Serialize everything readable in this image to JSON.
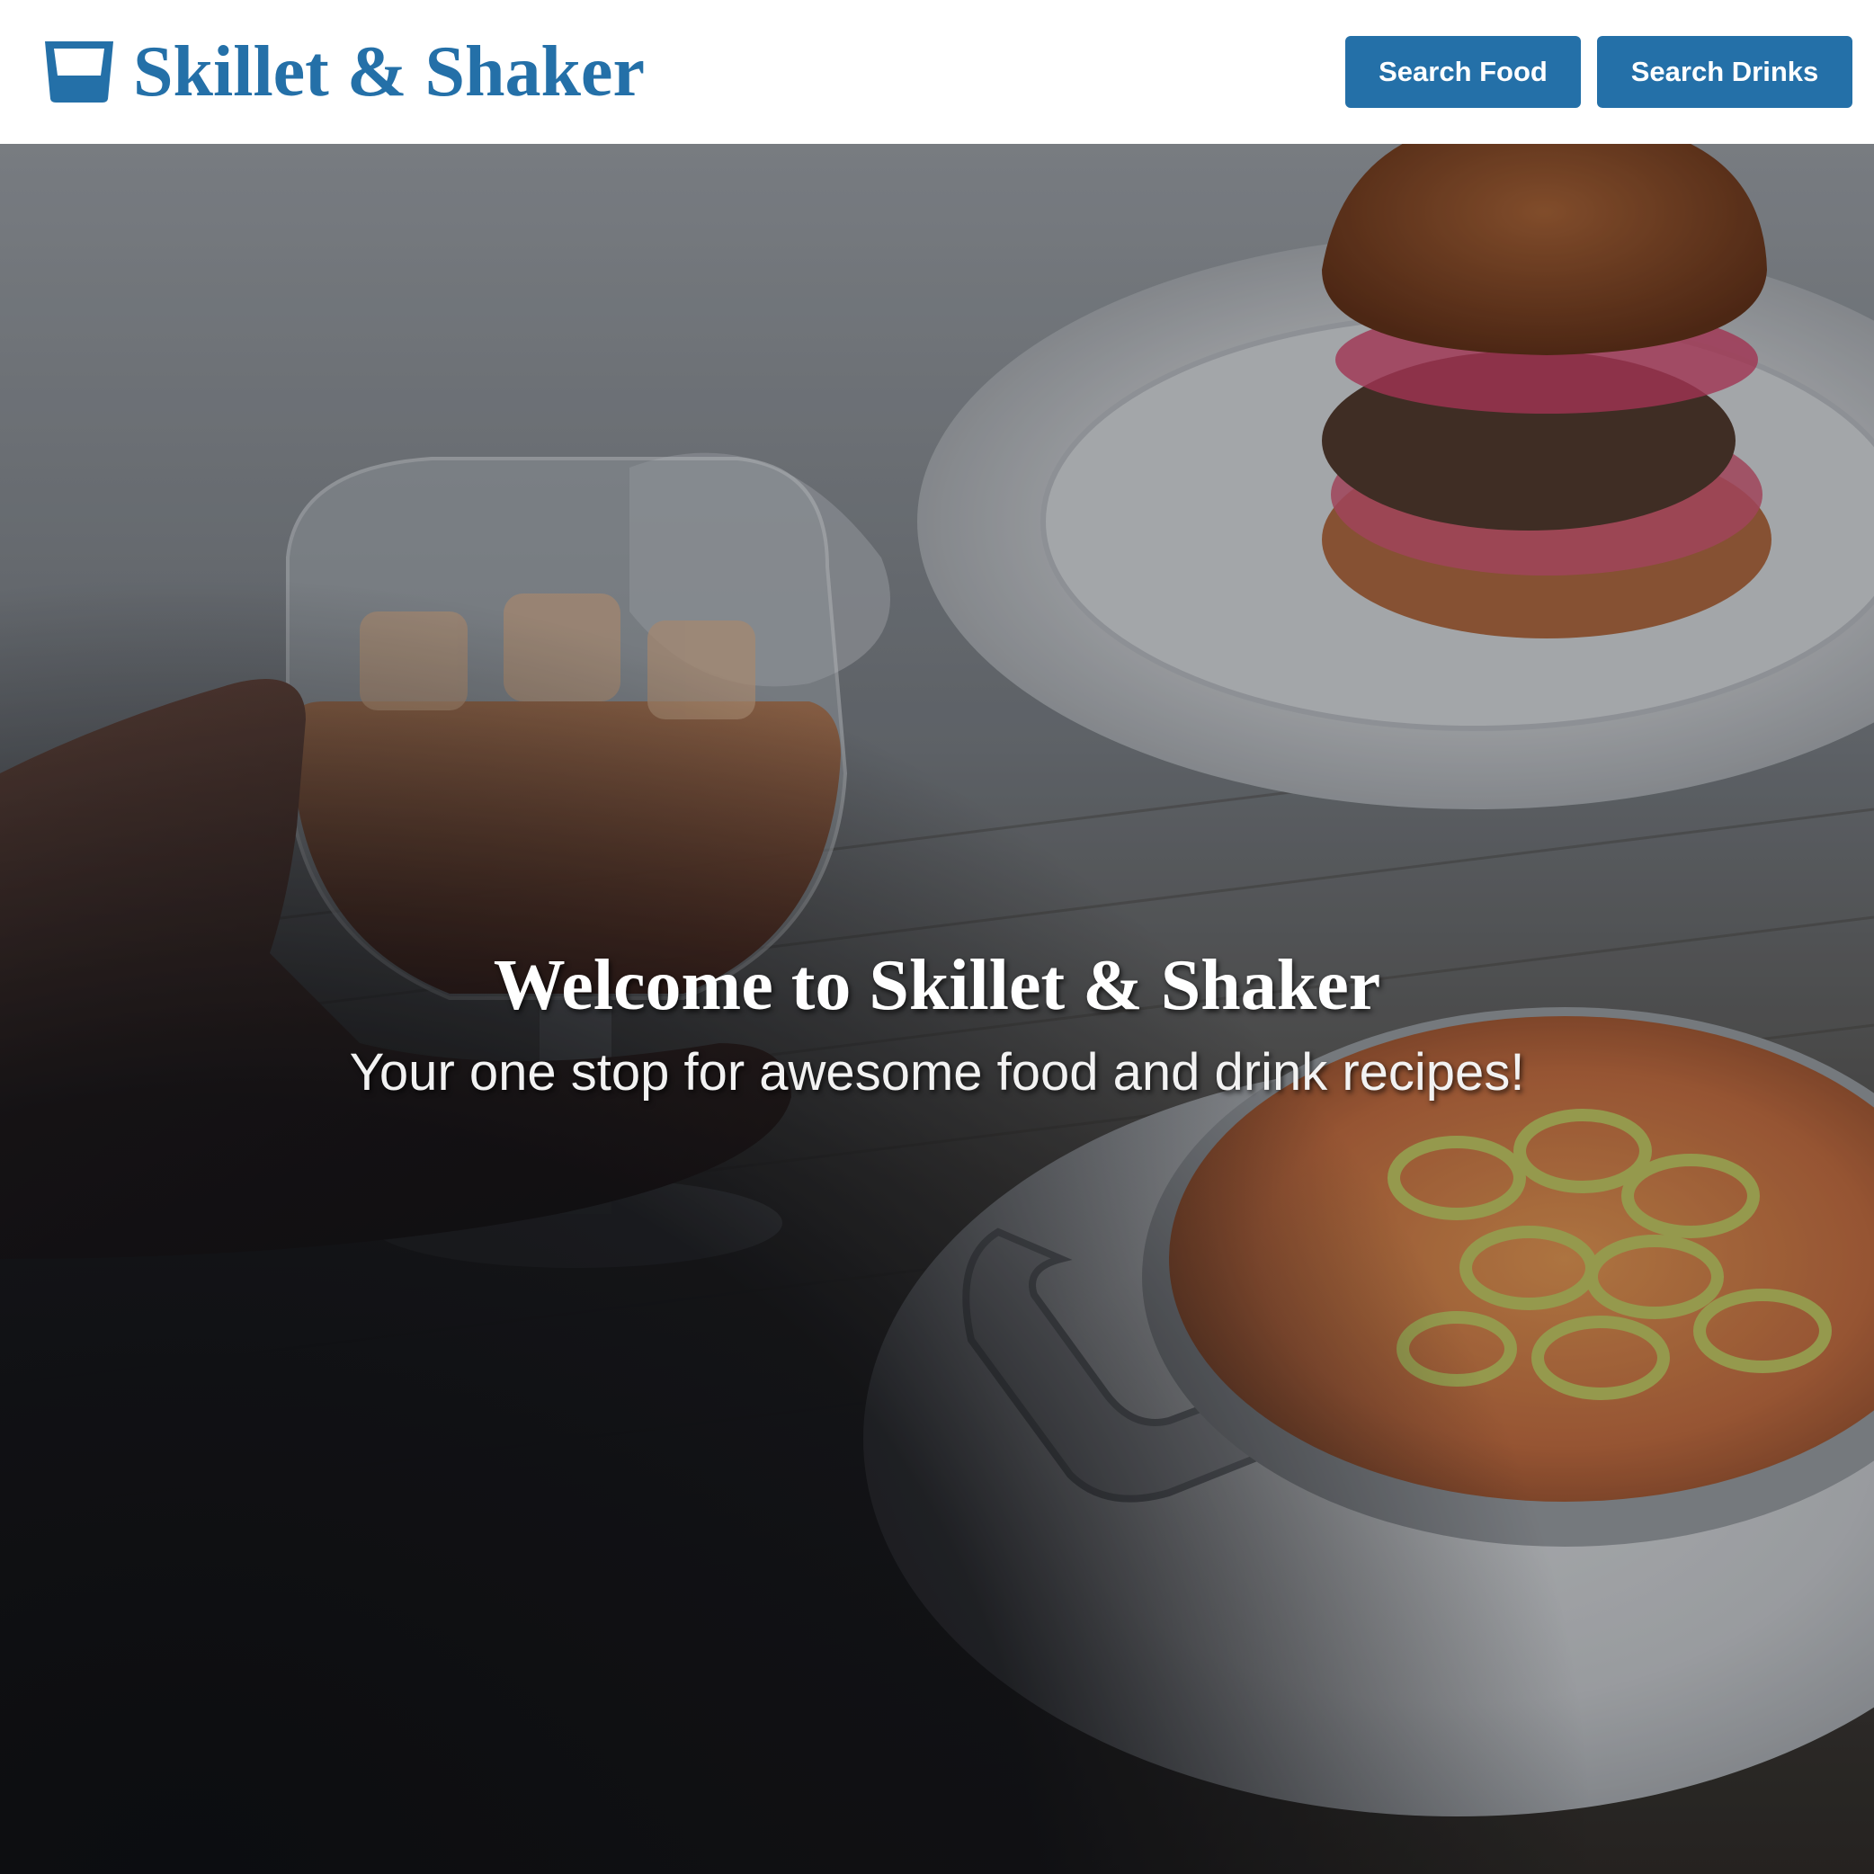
{
  "brand": {
    "name": "Skillet & Shaker",
    "icon": "glass-icon",
    "color": "#2470a8"
  },
  "nav": {
    "search_food_label": "Search Food",
    "search_drinks_label": "Search Drinks",
    "button_color": "#2470a8"
  },
  "hero": {
    "title": "Welcome to Skillet & Shaker",
    "subtitle": "Your one stop for awesome food and drink recipes!",
    "image_subjects": [
      "whiskey-glass-in-hand",
      "burger-on-plate",
      "mac-and-cheese-skillet-with-jalapenos",
      "wooden-table"
    ]
  }
}
